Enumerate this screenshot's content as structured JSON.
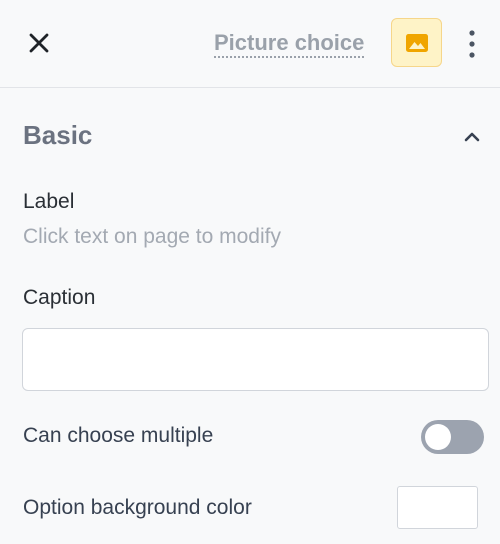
{
  "header": {
    "close_icon": "close-icon",
    "block_title": "Picture choice",
    "block_icon": "image-icon",
    "block_icon_color": "#f0a500",
    "block_icon_bg": "#fef3c7",
    "more_icon": "more-vertical-icon"
  },
  "section": {
    "title": "Basic",
    "collapse_icon": "chevron-up-icon"
  },
  "label_field": {
    "title": "Label",
    "hint": "Click text on page to modify"
  },
  "caption_field": {
    "title": "Caption",
    "value": "",
    "placeholder": ""
  },
  "multiple_choice": {
    "label": "Can choose multiple",
    "enabled": false
  },
  "option_bg_color": {
    "label": "Option background color",
    "value": "#ffffff"
  }
}
